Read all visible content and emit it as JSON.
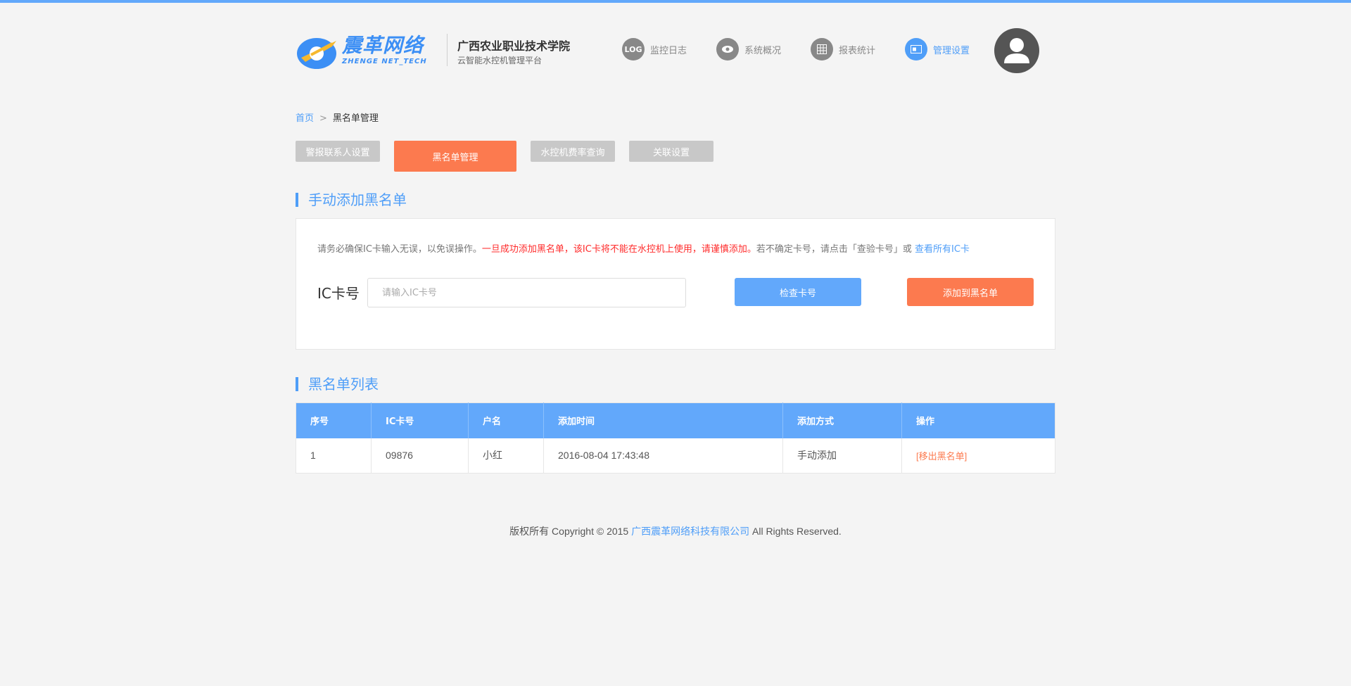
{
  "header": {
    "logo_text": "震革网络",
    "logo_sub": "ZHENGE NET_TECH",
    "school": "广西农业职业技术学院",
    "platform": "云智能水控机管理平台",
    "nav": [
      {
        "icon": "LOG",
        "label": "监控日志",
        "active": false
      },
      {
        "icon": "eye-icon",
        "label": "系统概况",
        "active": false
      },
      {
        "icon": "grid-icon",
        "label": "报表统计",
        "active": false
      },
      {
        "icon": "card-icon",
        "label": "管理设置",
        "active": true
      }
    ]
  },
  "breadcrumb": {
    "home": "首页",
    "sep": ">",
    "current": "黑名单管理"
  },
  "tabs": [
    {
      "label": "警报联系人设置",
      "active": false
    },
    {
      "label": "黑名单管理",
      "active": true
    },
    {
      "label": "水控机费率查询",
      "active": false
    },
    {
      "label": "关联设置",
      "active": false
    }
  ],
  "manual": {
    "title": "手动添加黑名单",
    "notice_a": "请务必确保IC卡输入无误，以免误操作。",
    "notice_warn": "一旦成功添加黑名单，该IC卡将不能在水控机上使用，请谨慎添加。",
    "notice_b": "若不确定卡号，请点击「查验卡号」或 ",
    "notice_link": "查看所有IC卡",
    "ic_label": "IC卡号",
    "ic_placeholder": "请输入IC卡号",
    "check_button": "检查卡号",
    "add_button": "添加到黑名单"
  },
  "list": {
    "title": "黑名单列表",
    "columns": [
      "序号",
      "IC卡号",
      "户名",
      "添加时间",
      "添加方式",
      "操作"
    ],
    "rows": [
      {
        "index": "1",
        "card": "09876",
        "name": "小红",
        "time": "2016-08-04 17:43:48",
        "method": "手动添加",
        "action": "[移出黑名单]"
      }
    ]
  },
  "footer": {
    "prefix": "版权所有 Copyright © 2015 ",
    "company": "广西震革网络科技有限公司",
    "suffix": " All Rights Reserved."
  },
  "colors": {
    "primary": "#62a8fb",
    "accent": "#fc7a4f",
    "warning": "#ff2b2b"
  }
}
